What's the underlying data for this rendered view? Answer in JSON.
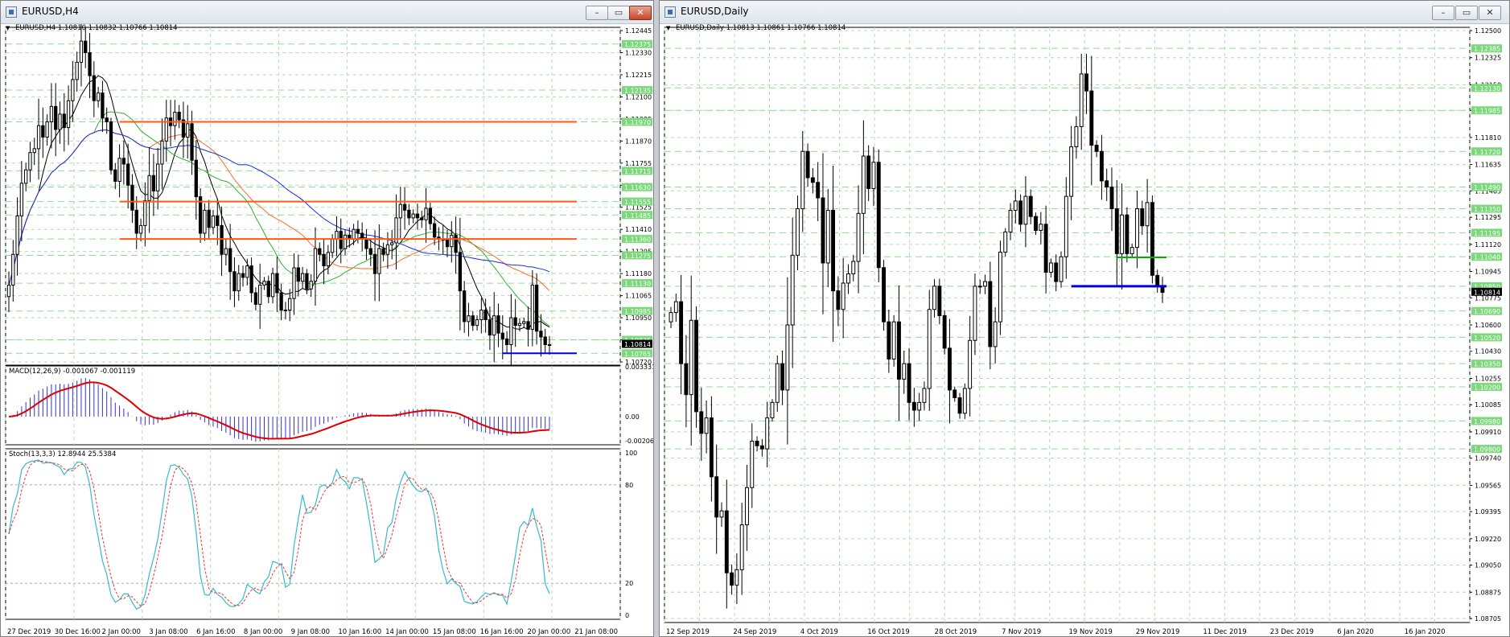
{
  "colors": {
    "background": "#ffffff",
    "grid": "#b4dab4",
    "candle": "#000000",
    "ma_black": "#000000",
    "ma_green": "#2db02d",
    "ma_orange": "#ff6a2a",
    "ma_blue": "#1a2ee0",
    "level_orange": "#ff5a10",
    "level_blue": "#0000dd",
    "level_green": "#00b000",
    "price_tag": "#7bd87b",
    "macd_hist": "#3333cc",
    "macd_signal": "#e00000",
    "stoch_main": "#33bbcc",
    "stoch_signal": "#ee3333"
  },
  "h4": {
    "window_title": "EURUSD,H4",
    "info": "EURUSD,H4  1.10810 1.10832 1.10766 1.10814",
    "controls": {
      "minimize": "–",
      "maximize": "▭",
      "close": "✕"
    },
    "macd_label": "MACD(12,26,9) -0.001067 -0.001119",
    "stoch_label": "Stoch(13,3,3) 12.8944 25.5384",
    "macd_ticks": [
      "0.003331",
      "0.00",
      "-0.002062"
    ],
    "stoch_ticks": [
      "100",
      "80",
      "20",
      "0"
    ],
    "current_price": "1.10814",
    "chart_data": {
      "type": "candlestick",
      "symbol": "EURUSD",
      "timeframe": "H4",
      "ylim": [
        1.1072,
        1.12445
      ],
      "price_ticks": [
        "1.12445",
        "1.12330",
        "1.12215",
        "1.12100",
        "1.11985",
        "1.11870",
        "1.11755",
        "1.11640",
        "1.11525",
        "1.11410",
        "1.11295",
        "1.11180",
        "1.11065",
        "1.10950",
        "1.10835",
        "1.10720"
      ],
      "x_labels": [
        "27 Dec 2019",
        "30 Dec 16:00",
        "2 Jan 00:00",
        "3 Jan 08:00",
        "6 Jan 16:00",
        "8 Jan 00:00",
        "9 Jan 08:00",
        "10 Jan 16:00",
        "14 Jan 00:00",
        "15 Jan 08:00",
        "16 Jan 16:00",
        "20 Jan 00:00",
        "21 Jan 08:00"
      ],
      "level_tags": [
        "1.12375",
        "1.12135",
        "1.11970",
        "1.11715",
        "1.11630",
        "1.11555",
        "1.11485",
        "1.11360",
        "1.11275",
        "1.11130",
        "1.10985",
        "1.10835",
        "1.10765"
      ],
      "resistance_levels": [
        1.1197,
        1.11555,
        1.1136
      ],
      "support_levels": [
        1.10765
      ],
      "close": [
        1.1112,
        1.1128,
        1.1148,
        1.1165,
        1.1172,
        1.1181,
        1.1183,
        1.1195,
        1.1189,
        1.1197,
        1.1205,
        1.1193,
        1.1201,
        1.1194,
        1.1208,
        1.1219,
        1.1228,
        1.1239,
        1.1233,
        1.1221,
        1.1208,
        1.1212,
        1.1199,
        1.1197,
        1.1172,
        1.1166,
        1.1178,
        1.1175,
        1.1164,
        1.1151,
        1.1139,
        1.1143,
        1.1156,
        1.1169,
        1.1161,
        1.1175,
        1.1187,
        1.1199,
        1.1195,
        1.1202,
        1.1198,
        1.1189,
        1.1196,
        1.1177,
        1.1158,
        1.1139,
        1.1151,
        1.1142,
        1.1148,
        1.1143,
        1.1128,
        1.1131,
        1.1119,
        1.1109,
        1.1118,
        1.1116,
        1.1122,
        1.1108,
        1.1102,
        1.1112,
        1.1114,
        1.1106,
        1.1118,
        1.1108,
        1.1099,
        1.1099,
        1.1105,
        1.1121,
        1.1114,
        1.1118,
        1.111,
        1.1114,
        1.1131,
        1.1128,
        1.1122,
        1.1129,
        1.1136,
        1.114,
        1.1131,
        1.1138,
        1.1136,
        1.1141,
        1.1139,
        1.1136,
        1.1131,
        1.1128,
        1.1118,
        1.1131,
        1.1128,
        1.1133,
        1.1134,
        1.1147,
        1.1154,
        1.1151,
        1.1147,
        1.1149,
        1.1147,
        1.1146,
        1.1152,
        1.1144,
        1.1137,
        1.1136,
        1.1136,
        1.1132,
        1.1138,
        1.1129,
        1.1109,
        1.1093,
        1.1096,
        1.1091,
        1.1094,
        1.1099,
        1.1094,
        1.1086,
        1.1096,
        1.1087,
        1.1084,
        1.1081,
        1.1095,
        1.1091,
        1.1092,
        1.1093,
        1.1089,
        1.1112,
        1.1088,
        1.1085,
        1.1081,
        1.1081
      ]
    }
  },
  "daily": {
    "window_title": "EURUSD,Daily",
    "info": "EURUSD,Daily  1.10813 1.10861 1.10766 1.10814",
    "controls": {
      "minimize": "–",
      "maximize": "▭",
      "close": "✕"
    },
    "current_price": "1.10814",
    "chart_data": {
      "type": "candlestick",
      "symbol": "EURUSD",
      "timeframe": "Daily",
      "ylim": [
        1.087,
        1.125
      ],
      "price_ticks": [
        "1.12500",
        "1.12325",
        "1.12150",
        "1.11985",
        "1.11810",
        "1.11635",
        "1.11465",
        "1.11295",
        "1.11120",
        "1.10945",
        "1.10775",
        "1.10600",
        "1.10430",
        "1.10255",
        "1.10085",
        "1.09910",
        "1.09740",
        "1.09565",
        "1.09395",
        "1.09220",
        "1.09050",
        "1.08875",
        "1.08705"
      ],
      "x_labels": [
        "12 Sep 2019",
        "24 Sep 2019",
        "4 Oct 2019",
        "16 Oct 2019",
        "28 Oct 2019",
        "7 Nov 2019",
        "19 Nov 2019",
        "29 Nov 2019",
        "11 Dec 2019",
        "23 Dec 2019",
        "6 Jan 2020",
        "16 Jan 2020"
      ],
      "level_tags": [
        "1.12385",
        "1.12130",
        "1.11985",
        "1.11720",
        "1.11490",
        "1.11350",
        "1.11195",
        "1.11040",
        "1.10850",
        "1.10690",
        "1.10520",
        "1.10350",
        "1.10200",
        "1.09980",
        "1.09800"
      ],
      "resistance_levels": [
        1.11036
      ],
      "support_levels": [
        1.1085
      ],
      "close": [
        1.1068,
        1.1075,
        1.1035,
        1.1015,
        1.1063,
        1.1004,
        1.099,
        1.1,
        1.0962,
        1.0936,
        1.094,
        1.09,
        1.0892,
        1.0902,
        1.0931,
        1.0955,
        1.0985,
        1.0982,
        1.098,
        1.1,
        1.101,
        1.1035,
        1.1018,
        1.106,
        1.1105,
        1.1135,
        1.1172,
        1.1155,
        1.1152,
        1.1142,
        1.11,
        1.1134,
        1.1082,
        1.107,
        1.1087,
        1.1093,
        1.1101,
        1.1132,
        1.1169,
        1.1148,
        1.1165,
        1.1097,
        1.1062,
        1.1038,
        1.1062,
        1.1025,
        1.1035,
        1.101,
        1.1005,
        1.101,
        1.1019,
        1.107,
        1.1085,
        1.1066,
        1.1045,
        1.1018,
        1.1013,
        1.1003,
        1.1019,
        1.105,
        1.1085,
        1.1085,
        1.1088,
        1.1046,
        1.1062,
        1.1107,
        1.112,
        1.1134,
        1.114,
        1.1125,
        1.1143,
        1.113,
        1.1121,
        1.1125,
        1.1094,
        1.11,
        1.1088,
        1.1104,
        1.1143,
        1.1175,
        1.1188,
        1.1222,
        1.1211,
        1.1176,
        1.1172,
        1.1153,
        1.1149,
        1.1135,
        1.1106,
        1.1131,
        1.1106,
        1.111,
        1.1135,
        1.1124,
        1.1139,
        1.1092,
        1.1085,
        1.1081
      ]
    }
  }
}
